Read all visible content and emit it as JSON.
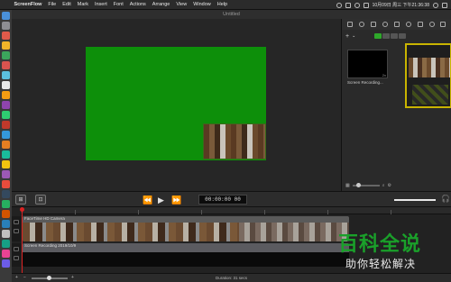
{
  "menubar": {
    "app_name": "ScreenFlow",
    "items": [
      "File",
      "Edit",
      "Mark",
      "Insert",
      "Font",
      "Actions",
      "Arrange",
      "View",
      "Window",
      "Help"
    ],
    "clock": "10月09日 周三 下午21:36:38"
  },
  "window": {
    "title": "Untitled"
  },
  "media": {
    "items": [
      {
        "name": "Screen Recording..."
      }
    ]
  },
  "transport": {
    "timecode": "00:00:00",
    "timecode_frames": "00"
  },
  "timeline": {
    "clips": [
      {
        "label": "FaceTime HD Camera"
      },
      {
        "label": "Screen Recording 2019/10/9"
      }
    ],
    "duration": "Duration: 31 secs"
  },
  "watermark": {
    "line1": "百科全说",
    "line2": "助你轻松解决"
  },
  "colors": {
    "canvas_green": "#0d8f0a",
    "selection_yellow": "#c9b400",
    "playhead_red": "#dd2222",
    "watermark_green": "#1aa02a"
  }
}
